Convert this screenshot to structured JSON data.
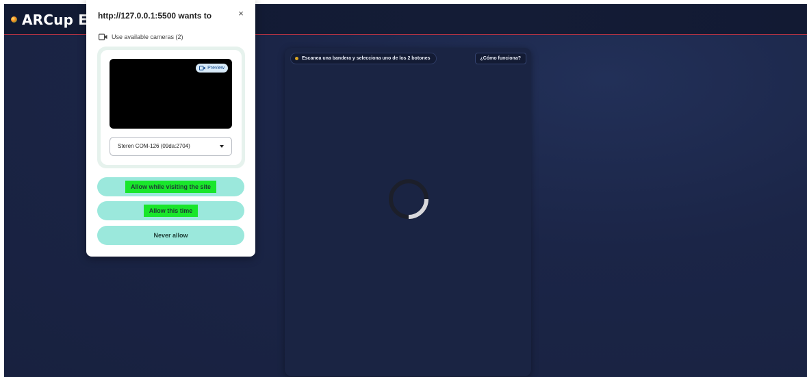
{
  "app": {
    "brand": "ARCup Ex",
    "scan_hint": "Escanea una bandera y selecciona uno de los 2 botones",
    "how_button": "¿Cómo funciona?"
  },
  "popup": {
    "title": "http://127.0.0.1:5500 wants to",
    "close_symbol": "×",
    "permission_label": "Use available cameras (2)",
    "preview_chip": "Preview",
    "camera_select_value": "Steren COM-126 (09da:2704)",
    "buttons": {
      "allow_site": "Allow while visiting the site",
      "allow_once": "Allow this time",
      "never": "Never allow"
    }
  },
  "colors": {
    "app_bg": "#1b2547",
    "topbar_border": "#b23344",
    "popup_button": "#9be8dc",
    "highlight": "#19e62b"
  },
  "icons": [
    "camera-icon",
    "preview-camera-icon",
    "close-icon",
    "chevron-down-icon",
    "loading-spinner"
  ]
}
